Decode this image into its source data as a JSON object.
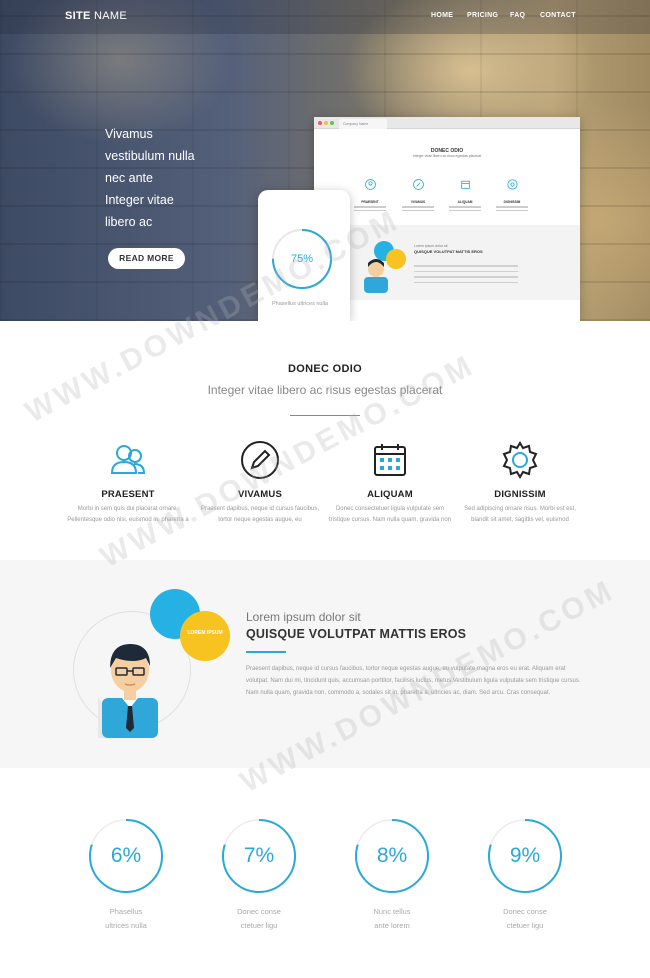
{
  "header": {
    "logo_bold": "SITE",
    "logo_light": " NAME",
    "nav": [
      "HOME",
      "PRICING",
      "FAQ",
      "CONTACT"
    ]
  },
  "hero": {
    "lines": [
      "Vivamus",
      "vestibulum nulla",
      "nec ante",
      "Integer vitae",
      "libero ac"
    ],
    "button": "READ MORE"
  },
  "mockup": {
    "browser_tab": "Company Name",
    "title": "DONEC ODIO",
    "subtitle": "Integer vitae libero ac risus egestas placerat",
    "features": [
      "PRAESENT",
      "VIVAMUS",
      "ALIQUAM",
      "DIGNISSIM"
    ],
    "band_kicker": "Lorem ipsum dolor sit",
    "band_title": "QUISQUE VOLUTPAT MATTIS EROS",
    "tablet_value": "75%",
    "tablet_fraction": 0.75,
    "tablet_label": "Phasellus ultrices nulla"
  },
  "section": {
    "title": "DONEC ODIO",
    "subtitle": "Integer vitae libero ac risus egestas placerat"
  },
  "features": [
    {
      "title": "PRAESENT",
      "icon": "users-icon",
      "text": "Morbi in sem quis dui placerat ornare. Pellentesque odio nisi, euismod in, pharetra a"
    },
    {
      "title": "VIVAMUS",
      "icon": "pencil-icon",
      "text": "Praesent dapibus, neque id cursus faucibus, tortor neque egestas augue, eu"
    },
    {
      "title": "ALIQUAM",
      "icon": "calendar-icon",
      "text": "Donec consectetuer ligula vulputate sem tristique cursus. Nam nulla quam, gravida non"
    },
    {
      "title": "DIGNISSIM",
      "icon": "gear-icon",
      "text": "Sed adipiscing ornare risus. Morbi est est, blandit sit amet, sagittis vel, euismod"
    }
  ],
  "band": {
    "bubble_text": "LOREM IPSUM",
    "kicker": "Lorem ipsum dolor sit",
    "title": "QUISQUE VOLUTPAT MATTIS EROS",
    "text": "Praesent dapibus, neque id cursus faucibus, tortor neque egestas augue, eu vulputate magna eros eu erat. Aliquam erat volutpat. Nam dui mi, tincidunt quis, accumsan porttitor, facilisis luctus, metus.Vestibulum ligula vulputate sem tristique cursus. Nam nulla quam, gravida non, commodo a, sodales sit in, pharetra a, ultricies ac, diam. Sed arcu. Cras consequat."
  },
  "stats": [
    {
      "value": "6%",
      "fraction": 0.06,
      "label1": "Phasellus",
      "label2": "ultrices nulla"
    },
    {
      "value": "7%",
      "fraction": 0.07,
      "label1": "Donec conse",
      "label2": "ctetuer ligu"
    },
    {
      "value": "8%",
      "fraction": 0.08,
      "label1": "Nunc tellus",
      "label2": "ante lorem"
    },
    {
      "value": "9%",
      "fraction": 0.09,
      "label1": "Donec conse",
      "label2": "ctetuer ligu"
    }
  ],
  "watermark": "WWW.DOWNDEMO.COM",
  "colors": {
    "accent": "#29a9d8",
    "bubble_blue": "#25b1e3",
    "bubble_yellow": "#f6c321",
    "band_bg": "#f6f6f6"
  }
}
